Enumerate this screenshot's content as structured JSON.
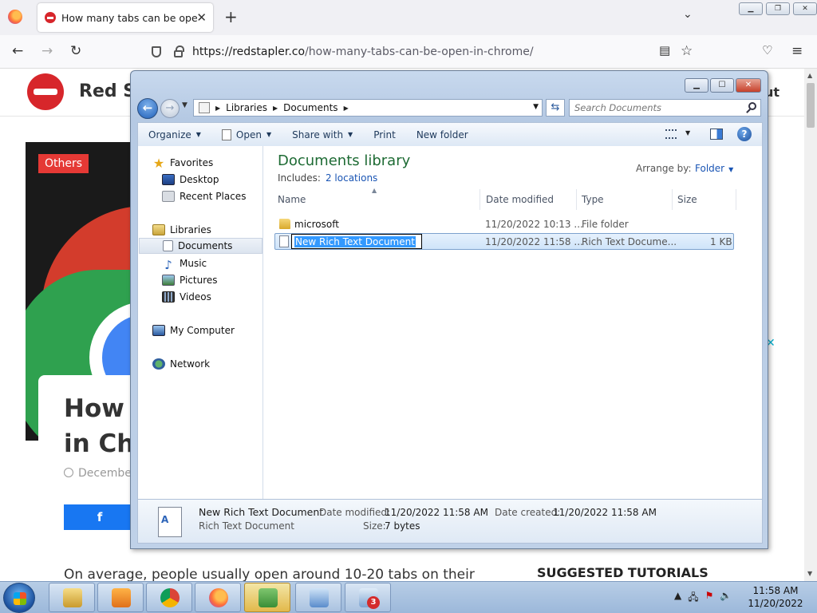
{
  "browser": {
    "tab_title": "How many tabs can be open in",
    "url_host": "redstapler.co",
    "url_path": "/how-many-tabs-can-be-open-in-chrome/",
    "new_tab_icon": "plus-icon",
    "tab_close_icon": "close-icon"
  },
  "webpage": {
    "site_name": "Red S",
    "nav_cut": "ut",
    "category_badge": "Others",
    "title_line1": "How",
    "title_line2": "in Ch",
    "date": "December",
    "share_icon": "facebook-icon",
    "intro_text": "On average, people usually open around 10-20 tabs on their",
    "suggested_heading": "SUGGESTED TUTORIALS"
  },
  "explorer": {
    "breadcrumbs": [
      "Libraries",
      "Documents"
    ],
    "search_placeholder": "Search Documents",
    "toolbar": {
      "organize": "Organize",
      "open": "Open",
      "share_with": "Share with",
      "print": "Print",
      "new_folder": "New folder"
    },
    "nav": {
      "favorites": "Favorites",
      "desktop": "Desktop",
      "recent_places": "Recent Places",
      "libraries": "Libraries",
      "documents": "Documents",
      "music": "Music",
      "pictures": "Pictures",
      "videos": "Videos",
      "my_computer": "My Computer",
      "network": "Network"
    },
    "library_title": "Documents library",
    "includes_label": "Includes:",
    "includes_link": "2 locations",
    "arrange_by_label": "Arrange by:",
    "arrange_by_value": "Folder",
    "columns": {
      "name": "Name",
      "date_modified": "Date modified",
      "type": "Type",
      "size": "Size"
    },
    "files": [
      {
        "name": "microsoft",
        "date": "11/20/2022 10:13 ...",
        "type": "File folder",
        "size": ""
      },
      {
        "name": "New Rich Text Document",
        "date": "11/20/2022 11:58 ...",
        "type": "Rich Text Docume...",
        "size": "1 KB"
      }
    ],
    "details": {
      "file_name": "New Rich Text Document",
      "file_type": "Rich Text Document",
      "date_modified_label": "Date modified:",
      "date_modified": "11/20/2022 11:58 AM",
      "date_created_label": "Date created:",
      "date_created": "11/20/2022 11:58 AM",
      "size_label": "Size:",
      "size": "7 bytes"
    }
  },
  "taskbar": {
    "badge_count": "3",
    "time": "11:58 AM",
    "date": "11/20/2022"
  }
}
